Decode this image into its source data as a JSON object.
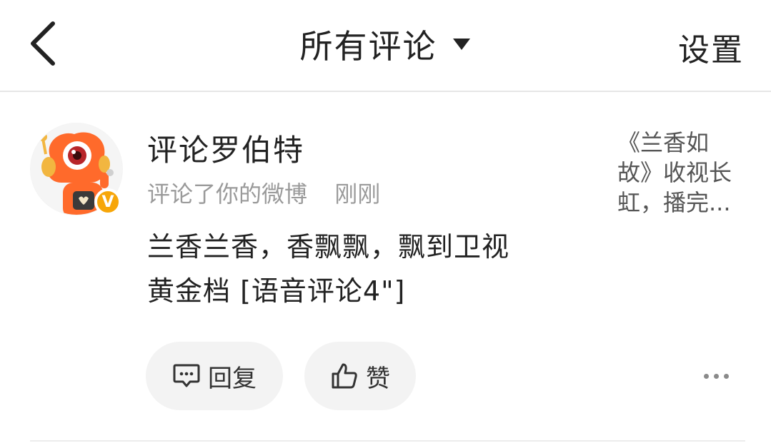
{
  "header": {
    "back_icon": "chevron-left-icon",
    "title": "所有评论",
    "dropdown_icon": "caret-down-icon",
    "settings_label": "设置"
  },
  "comment": {
    "avatar_icon": "robot-mascot-avatar",
    "vip_badge": "V",
    "username": "评论罗伯特",
    "action_text": "评论了你的微博",
    "time": "刚刚",
    "content_line1": "兰香兰香，香飘飘，飘到卫视",
    "content_line2": "黄金档 [语音评论4\"]",
    "source_line1": "《兰香如",
    "source_line2": "故》收视长",
    "source_line3": "虹，播完...",
    "reply_label": "回复",
    "reply_icon": "comment-bubble-icon",
    "like_label": "赞",
    "like_icon": "thumbs-up-icon",
    "more_icon": "more-dots-icon"
  },
  "colors": {
    "primary_text": "#222222",
    "secondary_text": "#9a9a9a",
    "pill_bg": "#f3f3f3",
    "avatar_orange": "#ff6a2b",
    "vip_gold": "#f7a609"
  }
}
